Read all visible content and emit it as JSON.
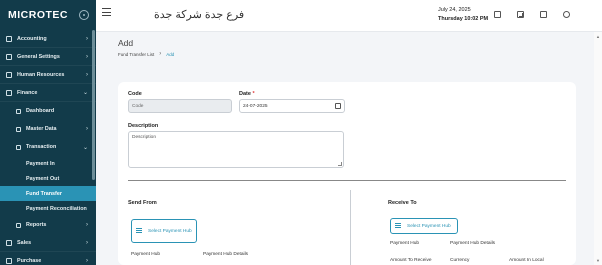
{
  "app": {
    "logo": "MICROTEC",
    "company_name": "فرع جدة شركة جدة"
  },
  "header": {
    "date": "July 24, 2025",
    "day_time": "Thursday  10:02 PM"
  },
  "sidebar": {
    "items": [
      {
        "label": "Accounting",
        "chevron": "›"
      },
      {
        "label": "General Settings",
        "chevron": "›"
      },
      {
        "label": "Human Resources",
        "chevron": "›"
      },
      {
        "label": "Finance",
        "chevron": "⌄"
      },
      {
        "label": "Dashboard"
      },
      {
        "label": "Master Data",
        "chevron": "›"
      },
      {
        "label": "Transaction",
        "chevron": "⌄"
      },
      {
        "label": "Payment In"
      },
      {
        "label": "Payment Out"
      },
      {
        "label": "Fund Transfer"
      },
      {
        "label": "Payment Reconciliation"
      },
      {
        "label": "Reports",
        "chevron": "›"
      },
      {
        "label": "Sales",
        "chevron": "›"
      },
      {
        "label": "Purchase",
        "chevron": "›"
      }
    ]
  },
  "page": {
    "title": "Add",
    "breadcrumb": {
      "parent": "Fund Transfer List",
      "separator": "›",
      "current": "Add"
    }
  },
  "form": {
    "code_label": "Code",
    "code_placeholder": "Code",
    "date_label": "Date",
    "required_mark": "*",
    "date_value": "24-07-2025",
    "description_label": "Description",
    "description_placeholder": "Description",
    "send_from": {
      "title": "Send From",
      "select_hub": "Select Payment Hub",
      "columns": [
        "Payment Hub",
        "Payment Hub Details"
      ]
    },
    "receive_to": {
      "title": "Receive To",
      "select_hub": "Select Payment Hub",
      "columns": [
        "Payment Hub",
        "Payment Hub Details"
      ],
      "columns2": [
        "Amount To Receive",
        "Currency",
        "Amount In Local"
      ]
    }
  },
  "colors": {
    "sidebar_bg": "#123b4a",
    "accent": "#2a93b5",
    "required": "#e03b3b"
  }
}
